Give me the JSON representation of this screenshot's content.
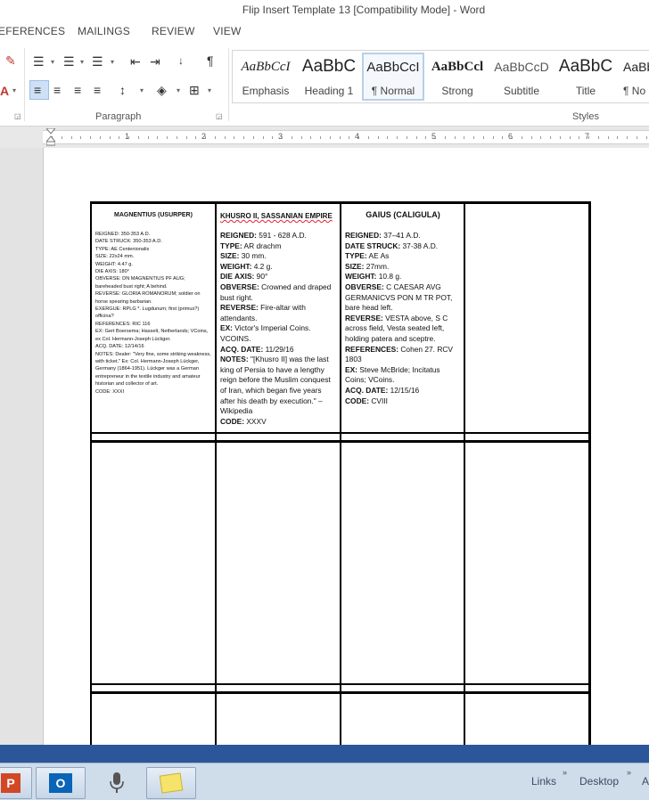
{
  "window": {
    "title": "Flip Insert Template 13 [Compatibility Mode] - Word"
  },
  "ribbon_tabs": [
    "EFERENCES",
    "MAILINGS",
    "REVIEW",
    "VIEW"
  ],
  "ribbon": {
    "paragraph_group_label": "Paragraph",
    "styles_group_label": "Styles",
    "styles": [
      {
        "sample": "AaBbCcI",
        "name": "Emphasis"
      },
      {
        "sample": "AaBbC",
        "name": "Heading 1"
      },
      {
        "sample": "AaBbCcI",
        "name": "¶ Normal"
      },
      {
        "sample": "AaBbCcl",
        "name": "Strong"
      },
      {
        "sample": "AaBbCcD",
        "name": "Subtitle"
      },
      {
        "sample": "AaBbC",
        "name": "Title"
      },
      {
        "sample": "AaBb",
        "name": "¶ No S"
      }
    ],
    "accent_color": "#2b579a",
    "selected_style_index": 2
  },
  "ruler": {
    "numbers": [
      "1",
      "2",
      "3",
      "4",
      "5",
      "6",
      "7"
    ]
  },
  "document": {
    "col1": {
      "title": "MAGNENTIUS (USURPER)",
      "lines": [
        "REIGNED: 350-353 A.D.",
        "DATE STRUCK: 350-353 A.D.",
        "TYPE: AE Centenionalis",
        "SIZE: 22x24 mm.",
        "WEIGHT: 4.47 g.",
        "DIE AXIS: 180°",
        "OBVERSE: DN MAGNENTIUS PF AUG; bareheaded bust right; A behind.",
        "REVERSE: GLORIA ROMANORUM; soldier on horse spearing barbarian.",
        "EXERGUE: RPLG *. Lugdunum; first (primus?) officina?",
        "REFERENCES: RIC 116",
        "EX: Gert Boersema; Hasselt, Netherlands; VCoins, ex Col. Hermann-Joseph Lückger.",
        "ACQ. DATE: 12/14/16",
        "NOTES: Dealer: \"Very fine, some striking weakness, with ticket.\" Ex: Col. Hermann-Joseph Lückger, Germany (1864-1951). Lückger was a German entrepreneur in the textile industry and amateur historian and collector of art.",
        "CODE: XXXI"
      ]
    },
    "col2": {
      "title": "KHUSRO II, SASSANIAN EMPIRE",
      "fields": [
        {
          "label": "REIGNED:",
          "value": "591 - 628 A.D."
        },
        {
          "label": "TYPE:",
          "value": "AR drachm"
        },
        {
          "label": "SIZE:",
          "value": "30 mm."
        },
        {
          "label": "WEIGHT:",
          "value": "4.2 g."
        },
        {
          "label": "DIE AXIS:",
          "value": "90°"
        },
        {
          "label": "OBVERSE:",
          "value": "Crowned and draped bust right."
        },
        {
          "label": "REVERSE:",
          "value": "Fire-altar with attendants."
        },
        {
          "label": "EX:",
          "value": "Victor's Imperial Coins. VCOINS."
        },
        {
          "label": "ACQ. DATE:",
          "value": "11/29/16"
        },
        {
          "label": "NOTES:",
          "value": "\"[Khusro II] was the last king of Persia to have a lengthy reign before the Muslim conquest of Iran, which began five years after his death by execution.\" –Wikipedia"
        },
        {
          "label": "CODE:",
          "value": "XXXV"
        }
      ]
    },
    "col3": {
      "title": "GAIUS (CALIGULA)",
      "fields": [
        {
          "label": "REIGNED:",
          "value": "37–41 A.D."
        },
        {
          "label": "DATE STRUCK:",
          "value": "37-38 A.D."
        },
        {
          "label": "TYPE:",
          "value": "AE As"
        },
        {
          "label": "SIZE:",
          "value": "27mm."
        },
        {
          "label": "WEIGHT:",
          "value": "10.8 g."
        },
        {
          "label": "OBVERSE:",
          "value": "C CAESAR AVG GERMANICVS PON M TR POT, bare head left."
        },
        {
          "label": "REVERSE:",
          "value": "VESTA above, S C across field, Vesta seated left, holding patera and sceptre."
        },
        {
          "label": "REFERENCES:",
          "value": "Cohen 27. RCV 1803"
        },
        {
          "label": "EX:",
          "value": "Steve McBride; Incitatus Coins; VCoins."
        },
        {
          "label": "ACQ. DATE:",
          "value": "12/15/16"
        },
        {
          "label": "CODE:",
          "value": "CVIII"
        }
      ]
    }
  },
  "taskbar": {
    "labels": [
      "Links",
      "Desktop",
      "A"
    ]
  }
}
